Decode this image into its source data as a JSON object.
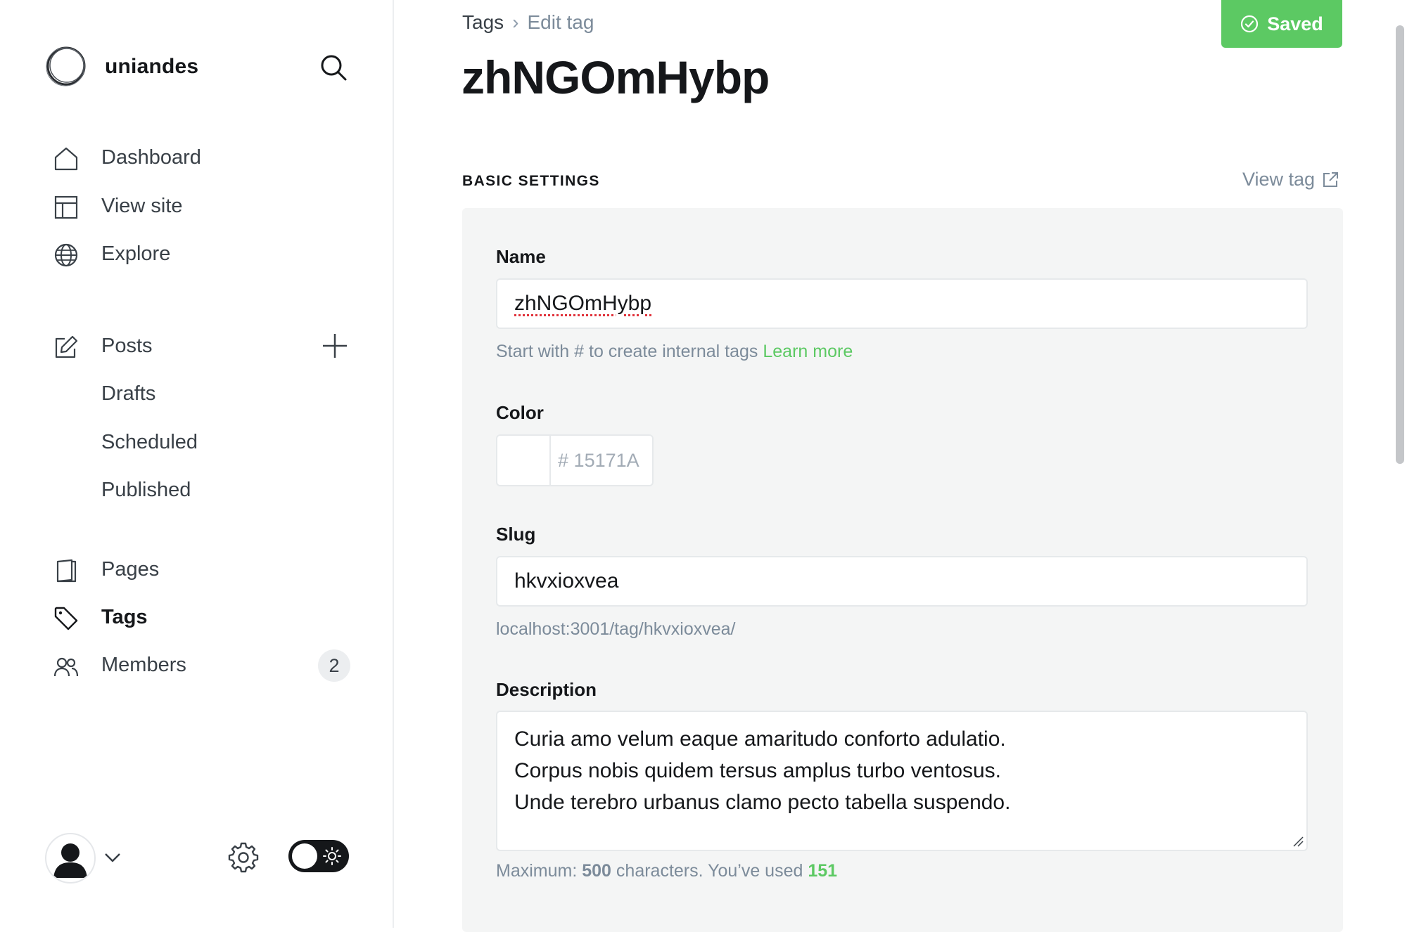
{
  "sidebar": {
    "brand": "uniandes",
    "nav": [
      {
        "label": "Dashboard"
      },
      {
        "label": "View site"
      },
      {
        "label": "Explore"
      }
    ],
    "posts": {
      "label": "Posts",
      "sub": [
        "Drafts",
        "Scheduled",
        "Published"
      ]
    },
    "nav2": [
      {
        "label": "Pages"
      },
      {
        "label": "Tags"
      },
      {
        "label": "Members",
        "badge": "2"
      }
    ]
  },
  "breadcrumb": {
    "parent": "Tags",
    "current": "Edit tag"
  },
  "save_button": {
    "label": "Saved",
    "color": "#5cc963"
  },
  "title": "zhNGOmHybp",
  "section": {
    "label": "BASIC SETTINGS",
    "view_tag": "View tag"
  },
  "form": {
    "name_label": "Name",
    "name_value": "zhNGOmHybp",
    "name_hint": "Start with # to create internal tags",
    "name_hint_link": "Learn more",
    "color_label": "Color",
    "color_hash": "#",
    "color_placeholder": "15171A",
    "slug_label": "Slug",
    "slug_value": "hkvxioxvea",
    "slug_url": "localhost:3001/tag/hkvxioxvea/",
    "description_label": "Description",
    "description_lines": [
      "Curia amo velum eaque amaritudo conforto adulatio.",
      "Corpus nobis quidem tersus amplus turbo ventosus.",
      "Unde terebro urbanus clamo pecto tabella suspendo."
    ],
    "count_prefix": "Maximum:",
    "count_max": "500",
    "count_middle": "characters. You’ve used",
    "count_used": "151"
  }
}
